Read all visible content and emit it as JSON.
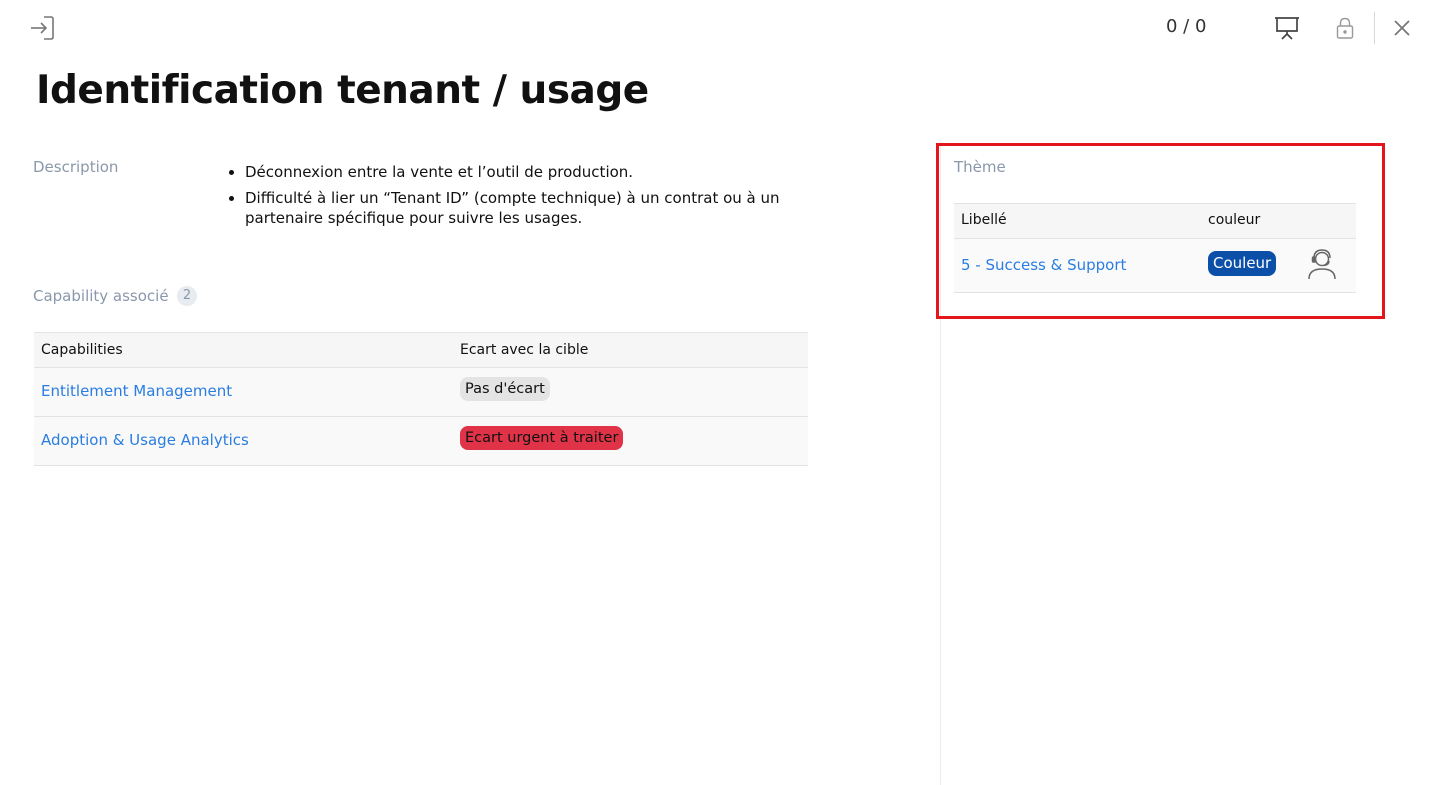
{
  "header": {
    "counter": "0 / 0",
    "icons": [
      "enter-icon",
      "presentation-icon",
      "lock-icon",
      "close-icon"
    ]
  },
  "page": {
    "title": "Identification tenant / usage"
  },
  "description": {
    "label": "Description",
    "items": [
      "Déconnexion entre la vente et l’outil de production.",
      "Difficulté à lier un “Tenant ID” (compte technique) à un contrat ou à un partenaire spécifique pour suivre les usages."
    ]
  },
  "capabilities": {
    "label": "Capability associé",
    "count": "2",
    "columns": [
      "Capabilities",
      "Ecart avec la cible"
    ],
    "rows": [
      {
        "name": "Entitlement Management",
        "gap": "Pas d'écart",
        "gap_color": "#e4e4e4"
      },
      {
        "name": "Adoption & Usage Analytics",
        "gap": "Ecart urgent à traiter",
        "gap_color": "#e03348"
      }
    ]
  },
  "theme": {
    "label": "Thème",
    "columns": [
      "Libellé",
      "couleur"
    ],
    "rows": [
      {
        "name": "5 - Success & Support",
        "color_label": "Couleur",
        "color": "#0b4fa8",
        "icon": "support-agent-icon"
      }
    ],
    "highlight_color": "#e3161b"
  }
}
